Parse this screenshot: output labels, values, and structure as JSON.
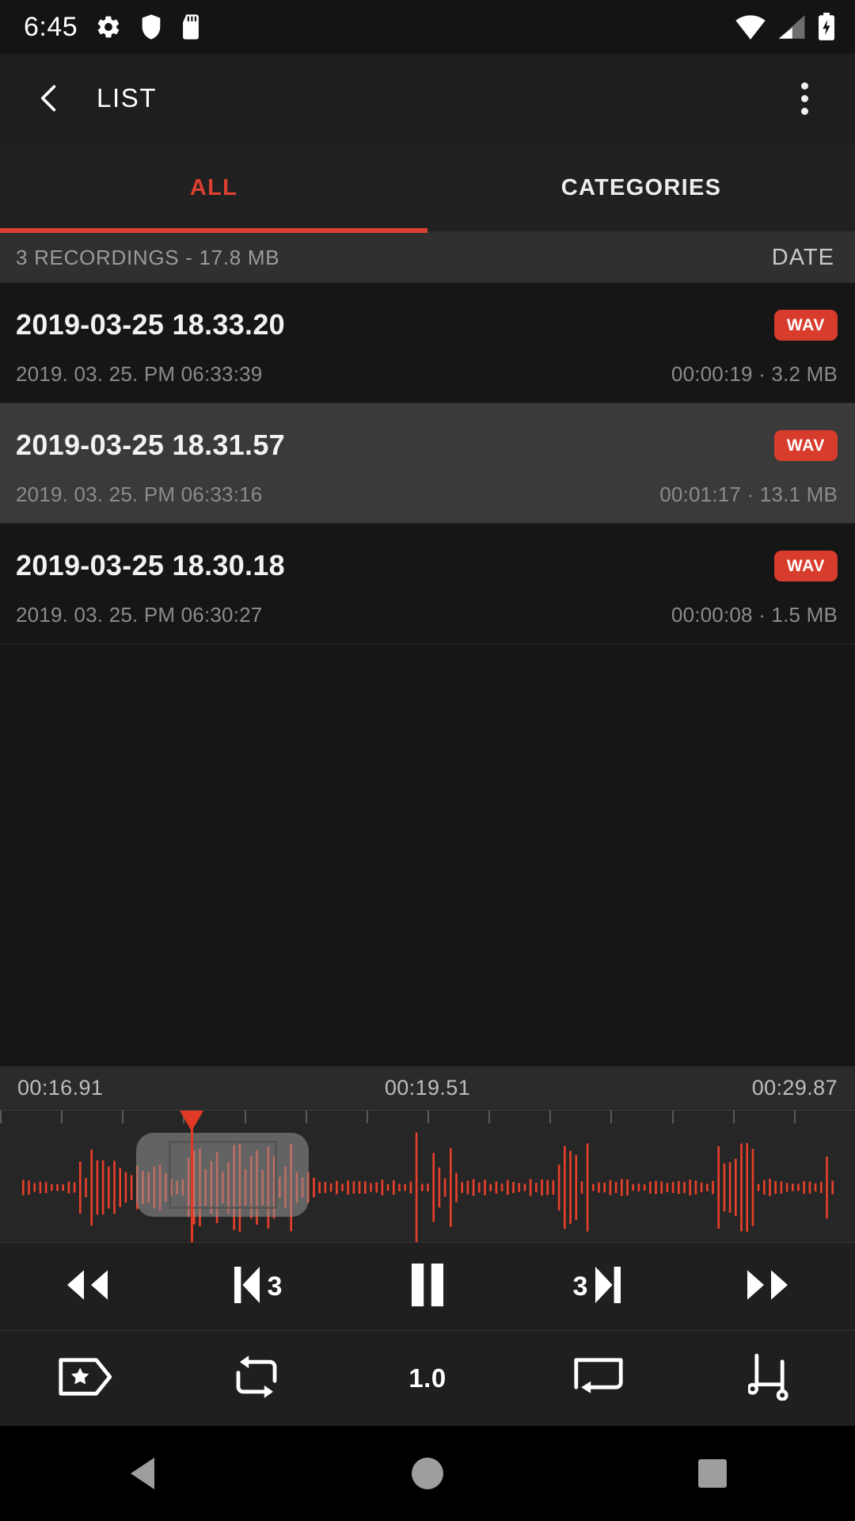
{
  "statusbar": {
    "clock": "6:45",
    "icons_left": [
      "gear-icon",
      "shield-icon",
      "sdcard-icon"
    ],
    "icons_right": [
      "wifi-icon",
      "cell-signal-icon",
      "battery-charging-icon"
    ]
  },
  "appbar": {
    "back_icon": "chevron-left-icon",
    "title": "LIST",
    "overflow_icon": "overflow-menu-icon"
  },
  "tabs": {
    "items": [
      {
        "label": "ALL",
        "active": true
      },
      {
        "label": "CATEGORIES",
        "active": false
      }
    ],
    "accent": "#d94030"
  },
  "summary": {
    "count_text": "3 RECORDINGS - 17.8 MB",
    "sort_label": "DATE"
  },
  "recordings": [
    {
      "title": "2019-03-25 18.33.20",
      "format": "WAV",
      "date": "2019. 03. 25. PM 06:33:39",
      "duration_size": "00:00:19 · 3.2 MB",
      "selected": false
    },
    {
      "title": "2019-03-25 18.31.57",
      "format": "WAV",
      "date": "2019. 03. 25. PM 06:33:16",
      "duration_size": "00:01:17 · 13.1 MB",
      "selected": true
    },
    {
      "title": "2019-03-25 18.30.18",
      "format": "WAV",
      "date": "2019. 03. 25. PM 06:30:27",
      "duration_size": "00:00:08 · 1.5 MB",
      "selected": false
    }
  ],
  "timeline": {
    "start_label": "00:16.91",
    "current_label": "00:19.51",
    "end_label": "00:29.87",
    "waveform_color": "#e8402a",
    "playhead_color": "#e03a25"
  },
  "transport": {
    "rewind": "rewind-icon",
    "skip_back_label": "3",
    "skip_back_icon": "skip-previous-icon",
    "pause": "pause-icon",
    "skip_forward_label": "3",
    "skip_forward_icon": "skip-next-icon",
    "fast_forward": "fast-forward-icon"
  },
  "tools": {
    "bookmark_icon": "bookmark-star-icon",
    "repeat_icon": "repeat-icon",
    "speed_label": "1.0",
    "region_icon": "region-select-icon",
    "trim_icon": "trim-icon"
  },
  "navbar": {
    "back": "nav-back-icon",
    "home": "nav-home-icon",
    "recents": "nav-recents-icon"
  }
}
